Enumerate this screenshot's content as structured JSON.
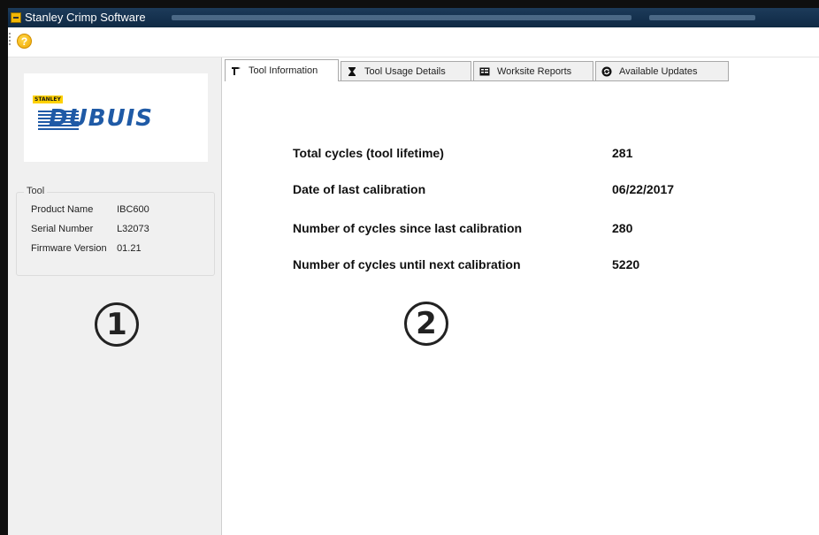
{
  "window": {
    "title": "Stanley Crimp Software"
  },
  "toolbar": {
    "help_label": "?"
  },
  "sidebar": {
    "logo": {
      "brand_small": "STANLEY",
      "brand_large": "DUBUIS"
    },
    "tool_group": {
      "legend": "Tool",
      "rows": [
        {
          "label": "Product Name",
          "value": "IBC600"
        },
        {
          "label": "Serial Number",
          "value": "L32073"
        },
        {
          "label": "Firmware Version",
          "value": "01.21"
        }
      ]
    },
    "callout_label": "1"
  },
  "tabs": [
    {
      "label": "Tool Information",
      "icon": "crimp-tool-icon",
      "active": true
    },
    {
      "label": "Tool Usage Details",
      "icon": "hourglass-icon",
      "active": false
    },
    {
      "label": "Worksite Reports",
      "icon": "report-icon",
      "active": false
    },
    {
      "label": "Available Updates",
      "icon": "update-icon",
      "active": false
    }
  ],
  "tool_information": {
    "rows": [
      {
        "label": "Total cycles (tool lifetime)",
        "value": "281"
      },
      {
        "label": "Date of last calibration",
        "value": "06/22/2017"
      },
      {
        "label": "Number of cycles since last calibration",
        "value": "280"
      },
      {
        "label": "Number of cycles until next calibration",
        "value": "5220"
      }
    ],
    "callout_label": "2"
  },
  "colors": {
    "titlebar": "#14304d",
    "help_icon": "#f1a800",
    "brand_yellow": "#ffd100",
    "brand_blue": "#1f5aa6"
  }
}
